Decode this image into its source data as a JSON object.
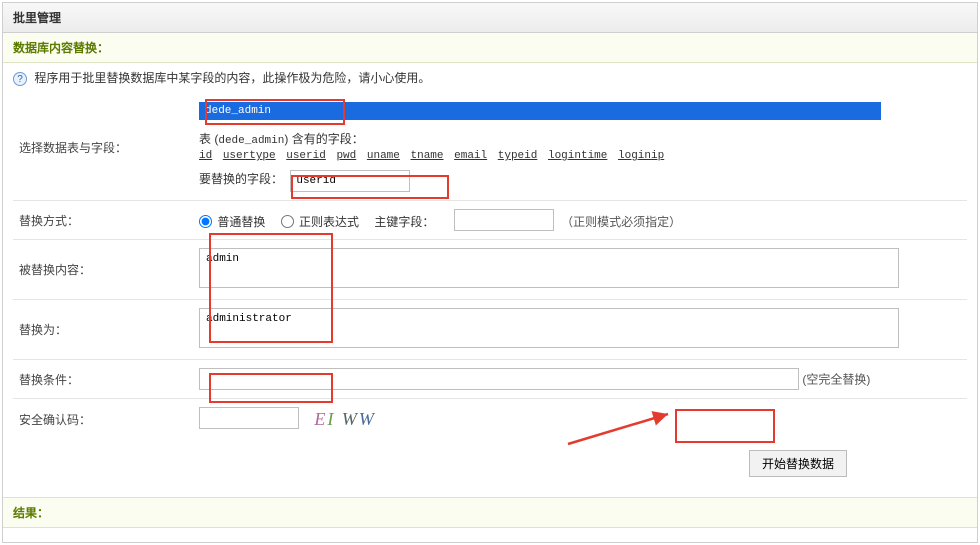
{
  "header": {
    "title": "批里管理"
  },
  "section": {
    "title": "数据库内容替换："
  },
  "info": {
    "text": "程序用于批里替换数据库中某字段的内容，此操作极为危险，请小心使用。"
  },
  "labels": {
    "select_table_field": "选择数据表与字段：",
    "replace_mode": "替换方式：",
    "replaced_content": "被替换内容：",
    "replace_to": "替换为：",
    "replace_cond": "替换条件：",
    "security_code": "安全确认码："
  },
  "dropdown": {
    "selected": "dede_admin"
  },
  "fieldlist": {
    "prefix": "表 (",
    "tablename": "dede_admin",
    "suffix": ") 含有的字段：",
    "fields": [
      "id",
      "usertype",
      "userid",
      "pwd",
      "uname",
      "tname",
      "email",
      "typeid",
      "logintime",
      "loginip"
    ]
  },
  "field_to_replace": {
    "label": "要替换的字段：",
    "value": "userid"
  },
  "mode": {
    "opt_normal": "普通替换",
    "opt_regex": "正则表达式",
    "pk_label": "主键字段：",
    "pk_value": "",
    "note": "（正则模式必须指定）"
  },
  "replaced_content_value": "admin",
  "replace_to_value": "administrator",
  "cond": {
    "value": "",
    "note": "(空完全替换)"
  },
  "captcha": {
    "value": "",
    "glyph1": "E",
    "glyph2": "I",
    "glyph3": "W",
    "glyph4": "W"
  },
  "submit": {
    "label": "开始替换数据"
  },
  "result": {
    "title": "结果："
  }
}
